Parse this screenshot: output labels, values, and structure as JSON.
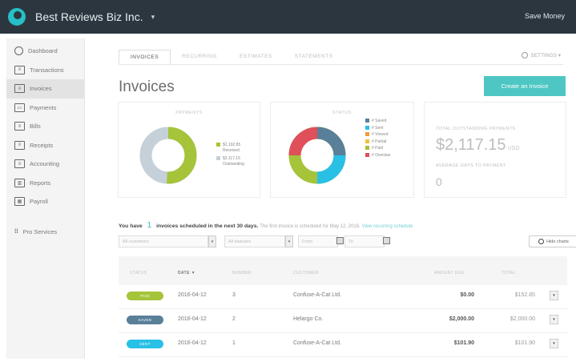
{
  "header": {
    "company": "Best Reviews Biz Inc.",
    "caret": "▾",
    "save_money": "Save Money"
  },
  "sidebar": {
    "items": [
      {
        "label": "Dashboard",
        "icon": "dashboard-icon",
        "active": false
      },
      {
        "label": "Transactions",
        "icon": "transactions-icon",
        "active": false
      },
      {
        "label": "Invoices",
        "icon": "invoices-icon",
        "active": true
      },
      {
        "label": "Payments",
        "icon": "payments-icon",
        "active": false
      },
      {
        "label": "Bills",
        "icon": "bills-icon",
        "active": false
      },
      {
        "label": "Receipts",
        "icon": "receipts-icon",
        "active": false
      },
      {
        "label": "Accounting",
        "icon": "accounting-icon",
        "active": false
      },
      {
        "label": "Reports",
        "icon": "reports-icon",
        "active": false
      },
      {
        "label": "Payroll",
        "icon": "payroll-icon",
        "active": false
      }
    ],
    "pro_services": "Pro Services"
  },
  "tabs": [
    "INVOICES",
    "RECURRING",
    "ESTIMATES",
    "STATEMENTS"
  ],
  "settings_label": "SETTINGS ▾",
  "page_title": "Invoices",
  "create_button": "Create an Invoice",
  "payments_card": {
    "title": "PAYMENTS",
    "received": "$2,192.85",
    "received_label": "Received",
    "outstanding": "$2,117.15",
    "outstanding_label": "Outstanding",
    "colors": {
      "received": "#a5c43a",
      "outstanding": "#c5d0d8"
    }
  },
  "status_card": {
    "title": "STATUS",
    "legend": [
      {
        "label": "# Saved",
        "color": "#5a7f99"
      },
      {
        "label": "# Sent",
        "color": "#29c0e6"
      },
      {
        "label": "# Viewed",
        "color": "#f19a3b"
      },
      {
        "label": "# Partial",
        "color": "#f2c23a"
      },
      {
        "label": "# Paid",
        "color": "#a5c43a"
      },
      {
        "label": "# Overdue",
        "color": "#e0505a"
      }
    ]
  },
  "totals_card": {
    "total_label": "TOTAL OUTSTANDING PAYMENTS",
    "total_value": "$2,117.15",
    "currency": "USD",
    "avg_label": "AVERAGE DAYS TO PAYMENT",
    "avg_value": "0"
  },
  "schedule": {
    "prefix": "You have",
    "count": "1",
    "middle": "invoices scheduled in the next 30 days.",
    "detail": "The first invoice is scheduled for May 12, 2016.",
    "link": "View recurring schedule"
  },
  "filters": {
    "customers": "All customers",
    "statuses": "All statuses",
    "from": "From",
    "to": "To",
    "hide_charts": "Hide charts"
  },
  "table": {
    "headers": {
      "status": "STATUS",
      "date": "DATE ▼",
      "number": "NUMBER",
      "customer": "CUSTOMER",
      "amount_due": "AMOUNT DUE",
      "total": "TOTAL"
    },
    "rows": [
      {
        "status": "PAID",
        "status_color": "#a5c43a",
        "date": "2016-04-12",
        "number": "3",
        "customer": "Confuse-A-Cat Ltd.",
        "amount_due": "$0.00",
        "total": "$152.85"
      },
      {
        "status": "SAVED",
        "status_color": "#5a7f99",
        "date": "2016-04-12",
        "number": "2",
        "customer": "Helargo Co.",
        "amount_due": "$2,000.00",
        "total": "$2,000.00"
      },
      {
        "status": "SENT",
        "status_color": "#29c0e6",
        "date": "2016-04-12",
        "number": "1",
        "customer": "Confuse-A-Cat Ltd.",
        "amount_due": "$101.90",
        "total": "$101.90"
      }
    ]
  }
}
